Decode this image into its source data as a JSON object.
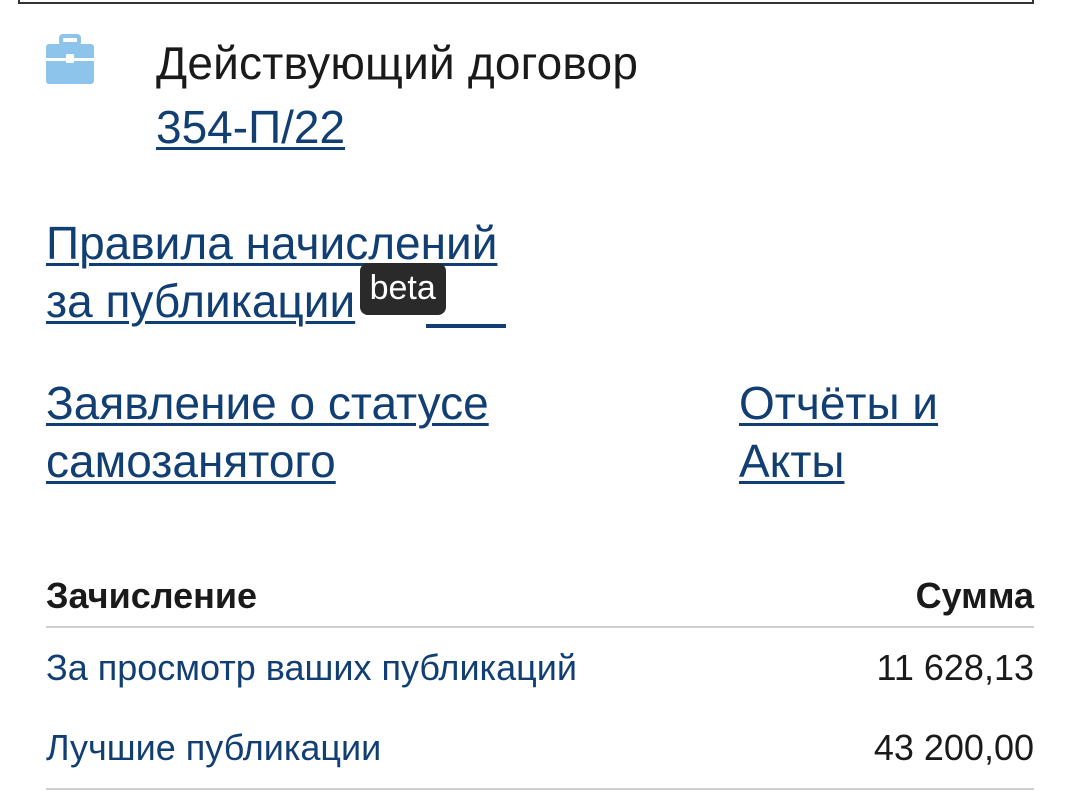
{
  "contract": {
    "title": "Действующий договор",
    "number": "354-П/22",
    "icon": "briefcase-icon"
  },
  "links": {
    "rules_line1": "Правила начислений",
    "rules_line2": "за публикации",
    "beta_badge": "beta",
    "statement_line1": "Заявление о статусе",
    "statement_line2": "самозанятого",
    "reports_line1": "Отчёты и",
    "reports_line2": "Акты"
  },
  "table": {
    "header_charge": "Зачисление",
    "header_sum": "Сумма",
    "rows": [
      {
        "label": "За просмотр ваших публикаций",
        "value": "11 628,13"
      },
      {
        "label": "Лучшие публикации",
        "value": "43 200,00"
      }
    ]
  },
  "colors": {
    "link": "#123f73",
    "icon": "#8cc4ec",
    "badge_bg": "#2a2a2a"
  }
}
